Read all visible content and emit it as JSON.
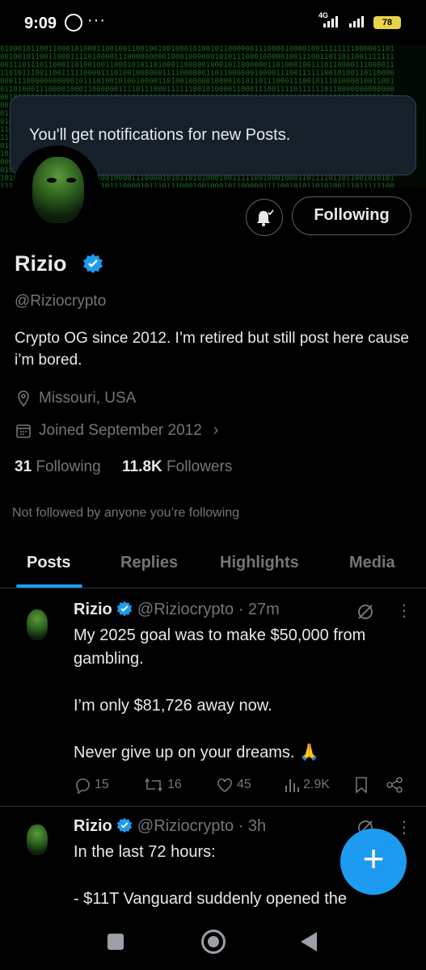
{
  "status_bar": {
    "time": "9:09",
    "more": "···",
    "network": "4G",
    "battery": "78"
  },
  "banner": {
    "toast_text": "You'll get notifications for new Posts."
  },
  "profile": {
    "name": "Rizio",
    "handle": "@Riziocrypto",
    "bio": "Crypto OG since 2012. I’m retired but still post here cause i’m bored.",
    "location": "Missouri, USA",
    "joined": "Joined September 2012",
    "following_count": "31",
    "following_label": "Following",
    "followers_count": "11.8K",
    "followers_label": "Followers",
    "not_followed_text": "Not followed by anyone you’re following",
    "follow_button_label": "Following"
  },
  "tabs": [
    {
      "label": "Posts",
      "active": true
    },
    {
      "label": "Replies"
    },
    {
      "label": "Highlights"
    },
    {
      "label": "Media"
    }
  ],
  "posts": [
    {
      "name": "Rizio",
      "meta": "@Riziocrypto · 27m",
      "text": "My 2025 goal was to make $50,000 from gambling.\n\nI’m only $81,726 away now.\n\nNever give up on your dreams. 🙏",
      "replies": "15",
      "reposts": "16",
      "likes": "45",
      "views": "2.9K"
    },
    {
      "name": "Rizio",
      "meta": "@Riziocrypto · 3h",
      "text": "In the last 72 hours:\n\n- $11T Vanguard suddenly opened the"
    }
  ],
  "fab": {
    "label": "+"
  },
  "colors": {
    "accent": "#1d9bf0",
    "background": "#000000",
    "muted": "#71767b",
    "toast_bg": "#15202b"
  }
}
